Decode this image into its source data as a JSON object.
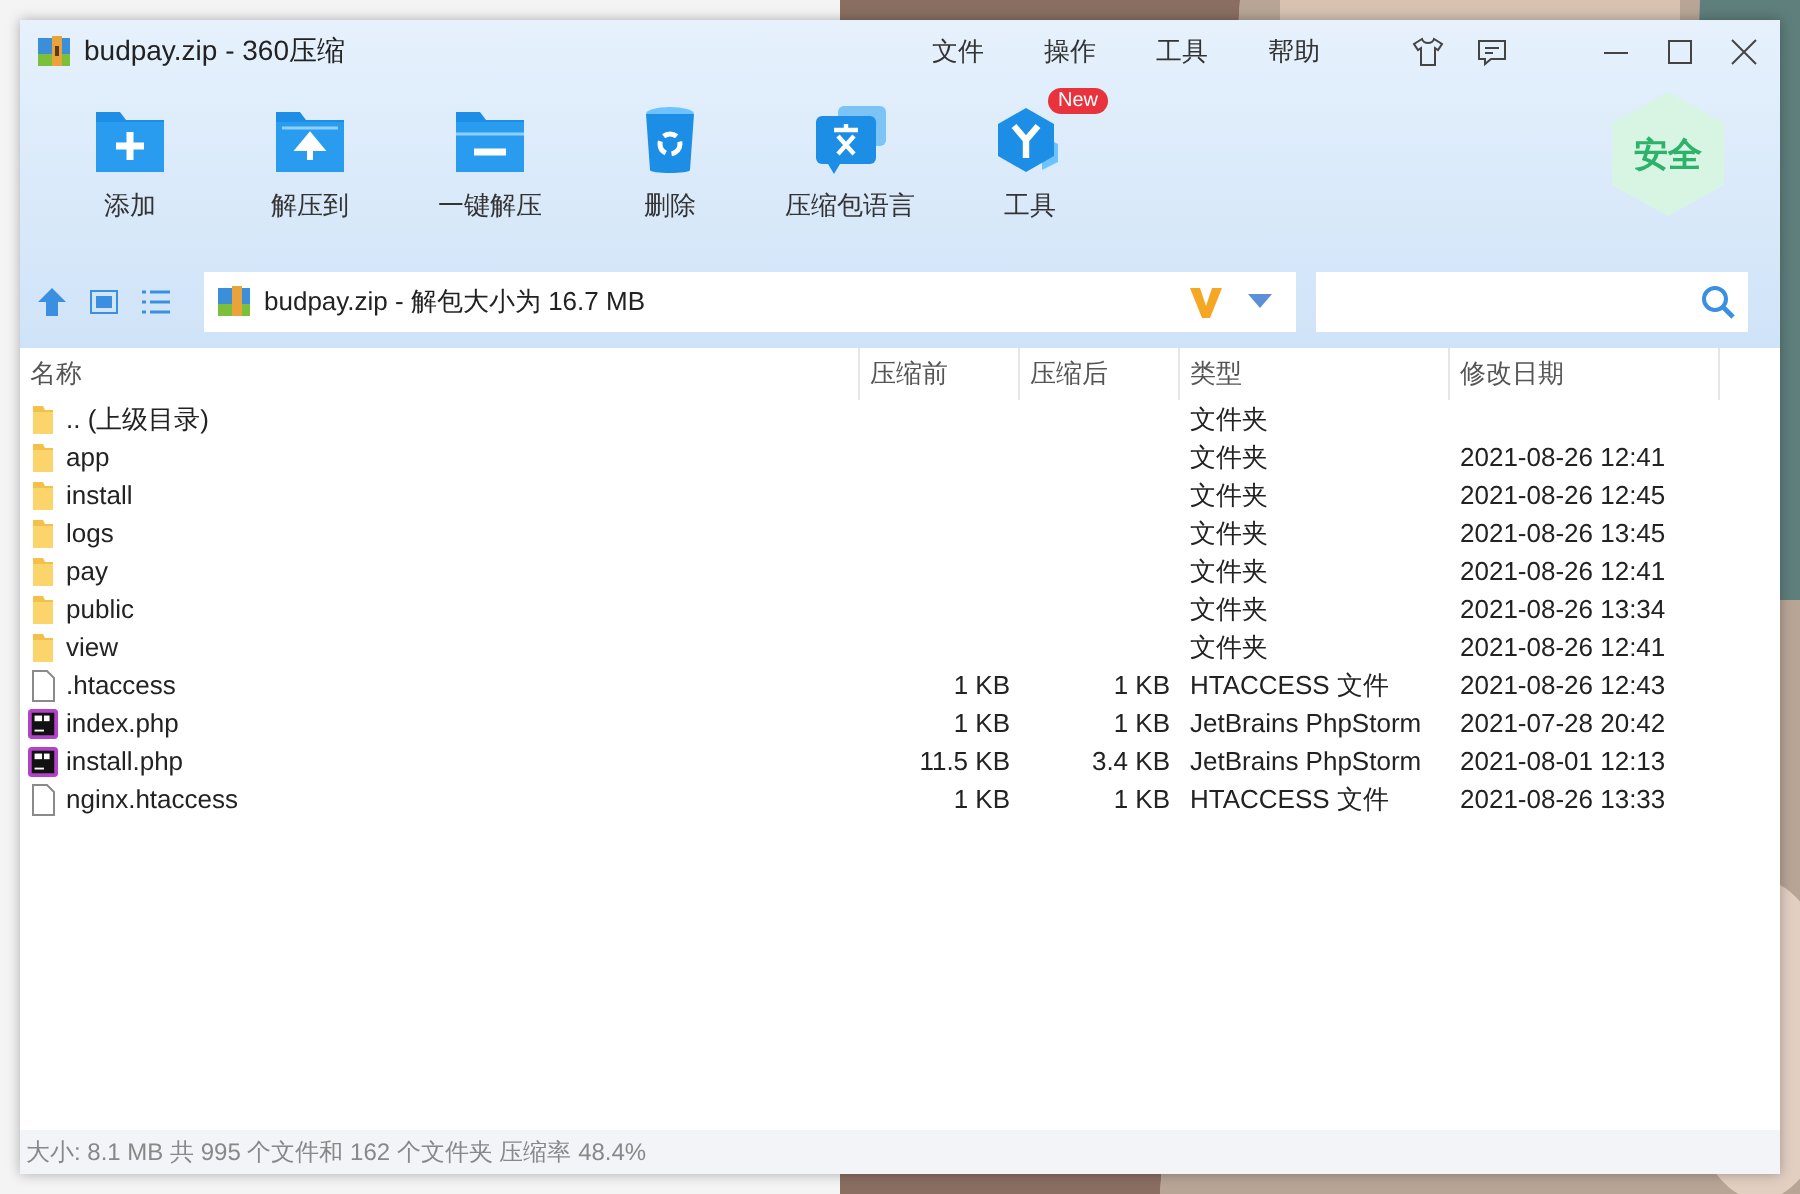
{
  "window": {
    "title": "budpay.zip - 360压缩"
  },
  "menu": [
    "文件",
    "操作",
    "工具",
    "帮助"
  ],
  "toolbar": [
    {
      "kind": "add",
      "label": "添加"
    },
    {
      "kind": "extract-to",
      "label": "解压到"
    },
    {
      "kind": "extract",
      "label": "一键解压"
    },
    {
      "kind": "delete",
      "label": "删除"
    },
    {
      "kind": "language",
      "label": "压缩包语言"
    },
    {
      "kind": "tools",
      "label": "工具",
      "badge": "New"
    }
  ],
  "security_badge": "安全",
  "path": "budpay.zip - 解包大小为 16.7 MB",
  "table": {
    "columns": [
      "名称",
      "压缩前",
      "压缩后",
      "类型",
      "修改日期"
    ],
    "rows": [
      {
        "kind": "folder",
        "name": ".. (上级目录)",
        "type": "文件夹"
      },
      {
        "kind": "folder",
        "name": "app",
        "type": "文件夹",
        "modified": "2021-08-26 12:41"
      },
      {
        "kind": "folder",
        "name": "install",
        "type": "文件夹",
        "modified": "2021-08-26 12:45"
      },
      {
        "kind": "folder",
        "name": "logs",
        "type": "文件夹",
        "modified": "2021-08-26 13:45"
      },
      {
        "kind": "folder",
        "name": "pay",
        "type": "文件夹",
        "modified": "2021-08-26 12:41"
      },
      {
        "kind": "folder",
        "name": "public",
        "type": "文件夹",
        "modified": "2021-08-26 13:34"
      },
      {
        "kind": "folder",
        "name": "view",
        "type": "文件夹",
        "modified": "2021-08-26 12:41"
      },
      {
        "kind": "file",
        "name": ".htaccess",
        "before": "1 KB",
        "after": "1 KB",
        "type": "HTACCESS 文件",
        "modified": "2021-08-26 12:43"
      },
      {
        "kind": "phpstorm",
        "name": "index.php",
        "before": "1 KB",
        "after": "1 KB",
        "type": "JetBrains PhpStorm",
        "modified": "2021-07-28 20:42"
      },
      {
        "kind": "phpstorm",
        "name": "install.php",
        "before": "11.5 KB",
        "after": "3.4 KB",
        "type": "JetBrains PhpStorm",
        "modified": "2021-08-01 12:13"
      },
      {
        "kind": "file",
        "name": "nginx.htaccess",
        "before": "1 KB",
        "after": "1 KB",
        "type": "HTACCESS 文件",
        "modified": "2021-08-26 13:33"
      }
    ]
  },
  "status_bar": "大小: 8.1 MB 共 995 个文件和 162 个文件夹 压缩率 48.4%"
}
